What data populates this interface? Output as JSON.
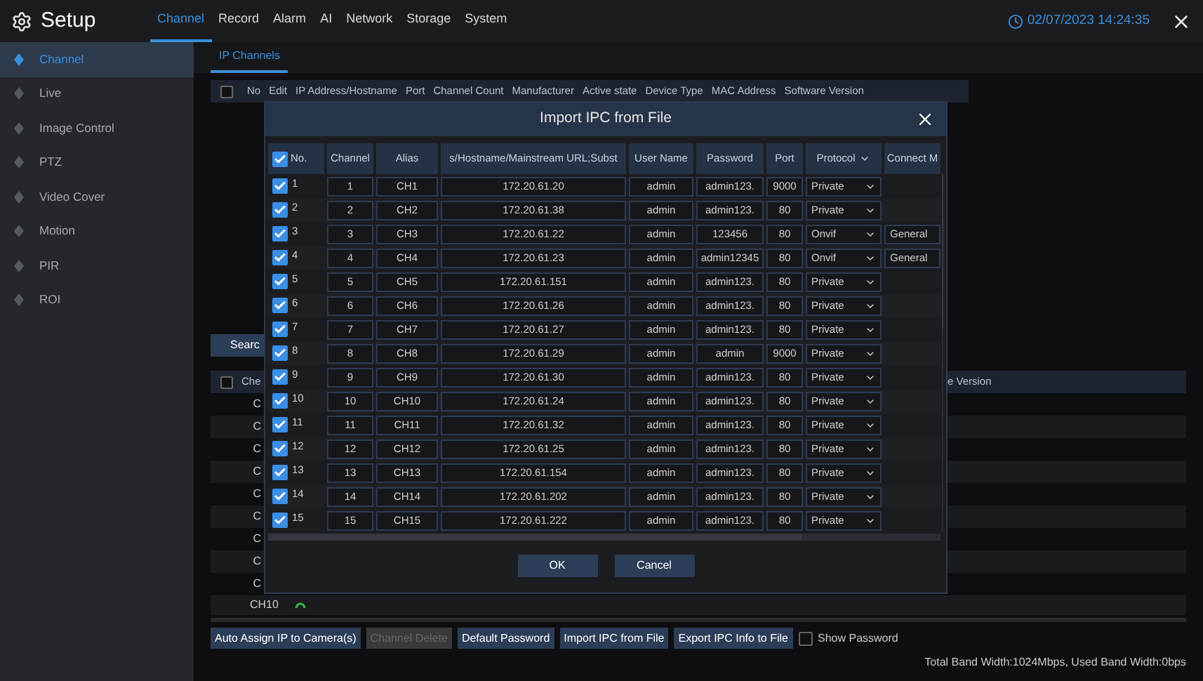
{
  "top_bar": {
    "title": "Setup",
    "tabs": [
      {
        "label": "Channel",
        "selected": true
      },
      {
        "label": "Record",
        "selected": false
      },
      {
        "label": "Alarm",
        "selected": false
      },
      {
        "label": "AI",
        "selected": false
      },
      {
        "label": "Network",
        "selected": false
      },
      {
        "label": "Storage",
        "selected": false
      },
      {
        "label": "System",
        "selected": false
      }
    ],
    "datetime": "02/07/2023 14:24:35"
  },
  "sidebar": {
    "items": [
      {
        "label": "Channel",
        "selected": true
      },
      {
        "label": "Live",
        "selected": false
      },
      {
        "label": "Image Control",
        "selected": false
      },
      {
        "label": "PTZ",
        "selected": false
      },
      {
        "label": "Video Cover",
        "selected": false
      },
      {
        "label": "Motion",
        "selected": false
      },
      {
        "label": "PIR",
        "selected": false
      },
      {
        "label": "ROI",
        "selected": false
      }
    ]
  },
  "sub_tabs": [
    {
      "label": "IP Channels",
      "selected": true
    }
  ],
  "channel_table": {
    "select_all_checked": false,
    "columns": [
      "No",
      "Edit",
      "IP Address/Hostname",
      "Port",
      "Channel Count",
      "Manufacturer",
      "Active state",
      "Device Type",
      "MAC Address",
      "Software Version"
    ]
  },
  "search_button": "Searc",
  "device_table": {
    "select_all_checked": false,
    "column_1": "Che",
    "column_last": "e Version",
    "rows": [
      "C",
      "C",
      "C",
      "C",
      "C",
      "C",
      "C",
      "C",
      "C"
    ],
    "last_row": {
      "channel": "CH10",
      "online": true
    }
  },
  "buttons": [
    {
      "label": "Auto Assign IP to Camera(s)",
      "disabled": false
    },
    {
      "label": "Channel Delete",
      "disabled": true
    },
    {
      "label": "Default Password",
      "disabled": false
    },
    {
      "label": "Import IPC from File",
      "disabled": false
    },
    {
      "label": "Export IPC Info to File",
      "disabled": false
    }
  ],
  "show_password": {
    "label": "Show Password",
    "checked": false
  },
  "bandwidth": "Total Band Width:1024Mbps, Used Band Width:0bps",
  "dialog": {
    "title": "Import IPC from File",
    "select_all_checked": true,
    "columns": [
      "No.",
      "Channel",
      "Alias",
      "s/Hostname/Mainstream URL;Subst",
      "User Name",
      "Password",
      "Port",
      "Protocol",
      "Connect M"
    ],
    "rows": [
      {
        "checked": true,
        "no": "1",
        "channel": "1",
        "alias": "CH1",
        "address": "172.20.61.20",
        "user": "admin",
        "password": "admin123.",
        "port": "9000",
        "protocol": "Private"
      },
      {
        "checked": true,
        "no": "2",
        "channel": "2",
        "alias": "CH2",
        "address": "172.20.61.38",
        "user": "admin",
        "password": "admin123.",
        "port": "80",
        "protocol": "Private"
      },
      {
        "checked": true,
        "no": "3",
        "channel": "3",
        "alias": "CH3",
        "address": "172.20.61.22",
        "user": "admin",
        "password": "123456",
        "port": "80",
        "protocol": "Onvif",
        "connect_mode": "General"
      },
      {
        "checked": true,
        "no": "4",
        "channel": "4",
        "alias": "CH4",
        "address": "172.20.61.23",
        "user": "admin",
        "password": "admin12345",
        "port": "80",
        "protocol": "Onvif",
        "connect_mode": "General"
      },
      {
        "checked": true,
        "no": "5",
        "channel": "5",
        "alias": "CH5",
        "address": "172.20.61.151",
        "user": "admin",
        "password": "admin123.",
        "port": "80",
        "protocol": "Private"
      },
      {
        "checked": true,
        "no": "6",
        "channel": "6",
        "alias": "CH6",
        "address": "172.20.61.26",
        "user": "admin",
        "password": "admin123.",
        "port": "80",
        "protocol": "Private"
      },
      {
        "checked": true,
        "no": "7",
        "channel": "7",
        "alias": "CH7",
        "address": "172.20.61.27",
        "user": "admin",
        "password": "admin123.",
        "port": "80",
        "protocol": "Private"
      },
      {
        "checked": true,
        "no": "8",
        "channel": "8",
        "alias": "CH8",
        "address": "172.20.61.29",
        "user": "admin",
        "password": "admin",
        "port": "9000",
        "protocol": "Private"
      },
      {
        "checked": true,
        "no": "9",
        "channel": "9",
        "alias": "CH9",
        "address": "172.20.61.30",
        "user": "admin",
        "password": "admin123.",
        "port": "80",
        "protocol": "Private"
      },
      {
        "checked": true,
        "no": "10",
        "channel": "10",
        "alias": "CH10",
        "address": "172.20.61.24",
        "user": "admin",
        "password": "admin123.",
        "port": "80",
        "protocol": "Private"
      },
      {
        "checked": true,
        "no": "11",
        "channel": "11",
        "alias": "CH11",
        "address": "172.20.61.32",
        "user": "admin",
        "password": "admin123.",
        "port": "80",
        "protocol": "Private"
      },
      {
        "checked": true,
        "no": "12",
        "channel": "12",
        "alias": "CH12",
        "address": "172.20.61.25",
        "user": "admin",
        "password": "admin123.",
        "port": "80",
        "protocol": "Private"
      },
      {
        "checked": true,
        "no": "13",
        "channel": "13",
        "alias": "CH13",
        "address": "172.20.61.154",
        "user": "admin",
        "password": "admin123.",
        "port": "80",
        "protocol": "Private"
      },
      {
        "checked": true,
        "no": "14",
        "channel": "14",
        "alias": "CH14",
        "address": "172.20.61.202",
        "user": "admin",
        "password": "admin123.",
        "port": "80",
        "protocol": "Private"
      },
      {
        "checked": true,
        "no": "15",
        "channel": "15",
        "alias": "CH15",
        "address": "172.20.61.222",
        "user": "admin",
        "password": "admin123.",
        "port": "80",
        "protocol": "Private"
      }
    ],
    "ok": "OK",
    "cancel": "Cancel"
  }
}
